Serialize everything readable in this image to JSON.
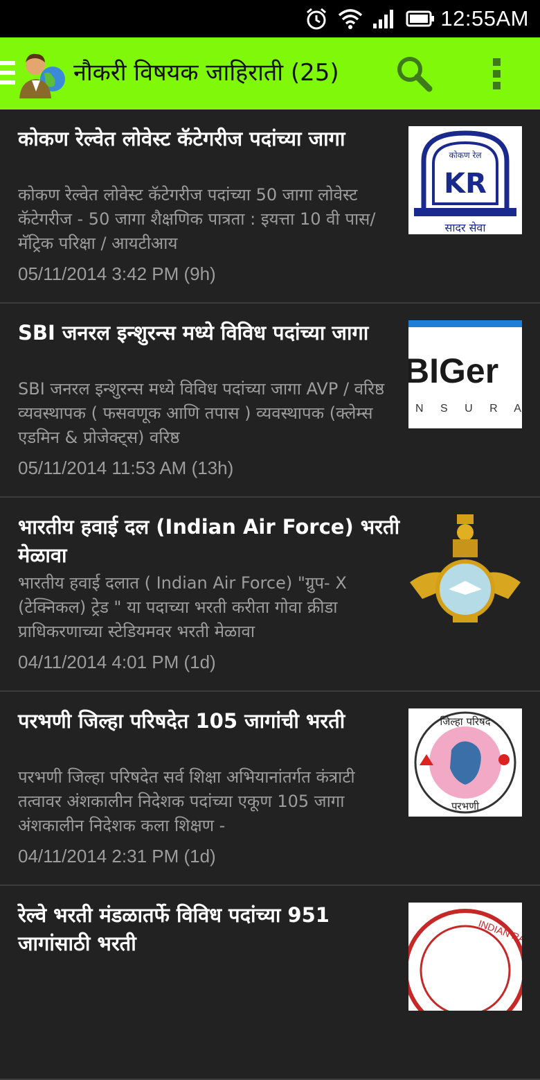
{
  "status_bar": {
    "time": "12:55AM"
  },
  "action_bar": {
    "title": "नौकरी विषयक जाहिराती (25)"
  },
  "items": [
    {
      "title": "कोकण रेल्वेत लोवेस्ट कॅटेगरीज पदांच्या जागा",
      "desc": "कोकण रेल्वेत लोवेस्ट   कॅटेगरीज पदांच्या 50 जागा लोवेस्ट कॅटेगरीज - 50 जागा  शैक्षणिक पात्रता : इयत्ता 10 वी पास/ मॅट्रिक परिक्षा / आयटीआय",
      "date": "05/11/2014 3:42 PM (9h)",
      "thumb_text_top": "कोकण रेल",
      "thumb_text_bottom": "सादर सेवा",
      "thumb_logo": "KR"
    },
    {
      "title": "SBI जनरल इन्शुरन्स मध्ये विविध पदांच्या जागा",
      "desc": "SBI जनरल इन्शुरन्स मध्ये विविध पदांच्या जागा AVP / वरिष्ठ व्यवस्थापक ( फसवणूक आणि तपास )  व्यवस्थापक (क्लेम्स एडमिन & प्रोजेक्ट्स) वरिष्ठ",
      "date": "05/11/2014 11:53 AM (13h)",
      "thumb_logo": "BIGer",
      "thumb_sub": "N S U R A"
    },
    {
      "title": "भारतीय हवाई दल (Indian Air Force) भरती मेळावा",
      "desc": "भारतीय हवाई दलात ( Indian Air Force) \"ग्रुप- X (टेक्निकल) ट्रेड \" या पदाच्या भरती करीता गोवा क्रीडा प्राधिकरणाच्या स्टेडियमवर भरती मेळावा",
      "date": "04/11/2014 4:01 PM (1d)"
    },
    {
      "title": "परभणी जिल्हा परिषदेत 105 जागांची भरती",
      "desc": "परभणी जिल्हा परिषदेत सर्व शिक्षा अभियानांतर्गत कंत्राटी तत्वावर अंशकालीन निदेशक पदांच्या एकूण 105  जागा  अंशकालीन निदेशक कला शिक्षण -",
      "date": "04/11/2014 2:31 PM (1d)",
      "thumb_text_top": "जिल्हा परिषद",
      "thumb_text_bottom": "परभणी"
    },
    {
      "title": "रेल्वे भरती मंडळातर्फे विविध पदांच्या 951 जागांसाठी भरती",
      "desc": "",
      "date": "",
      "thumb_text_top": "INDIAN RAILW"
    }
  ],
  "colors": {
    "action_bar": "#7ff80a",
    "background": "#222222",
    "text_secondary": "#9d9d9d"
  },
  "icons": [
    "alarm-icon",
    "wifi-icon",
    "signal-icon",
    "battery-icon",
    "drawer-icon",
    "app-logo-icon",
    "search-icon",
    "overflow-menu-icon"
  ]
}
